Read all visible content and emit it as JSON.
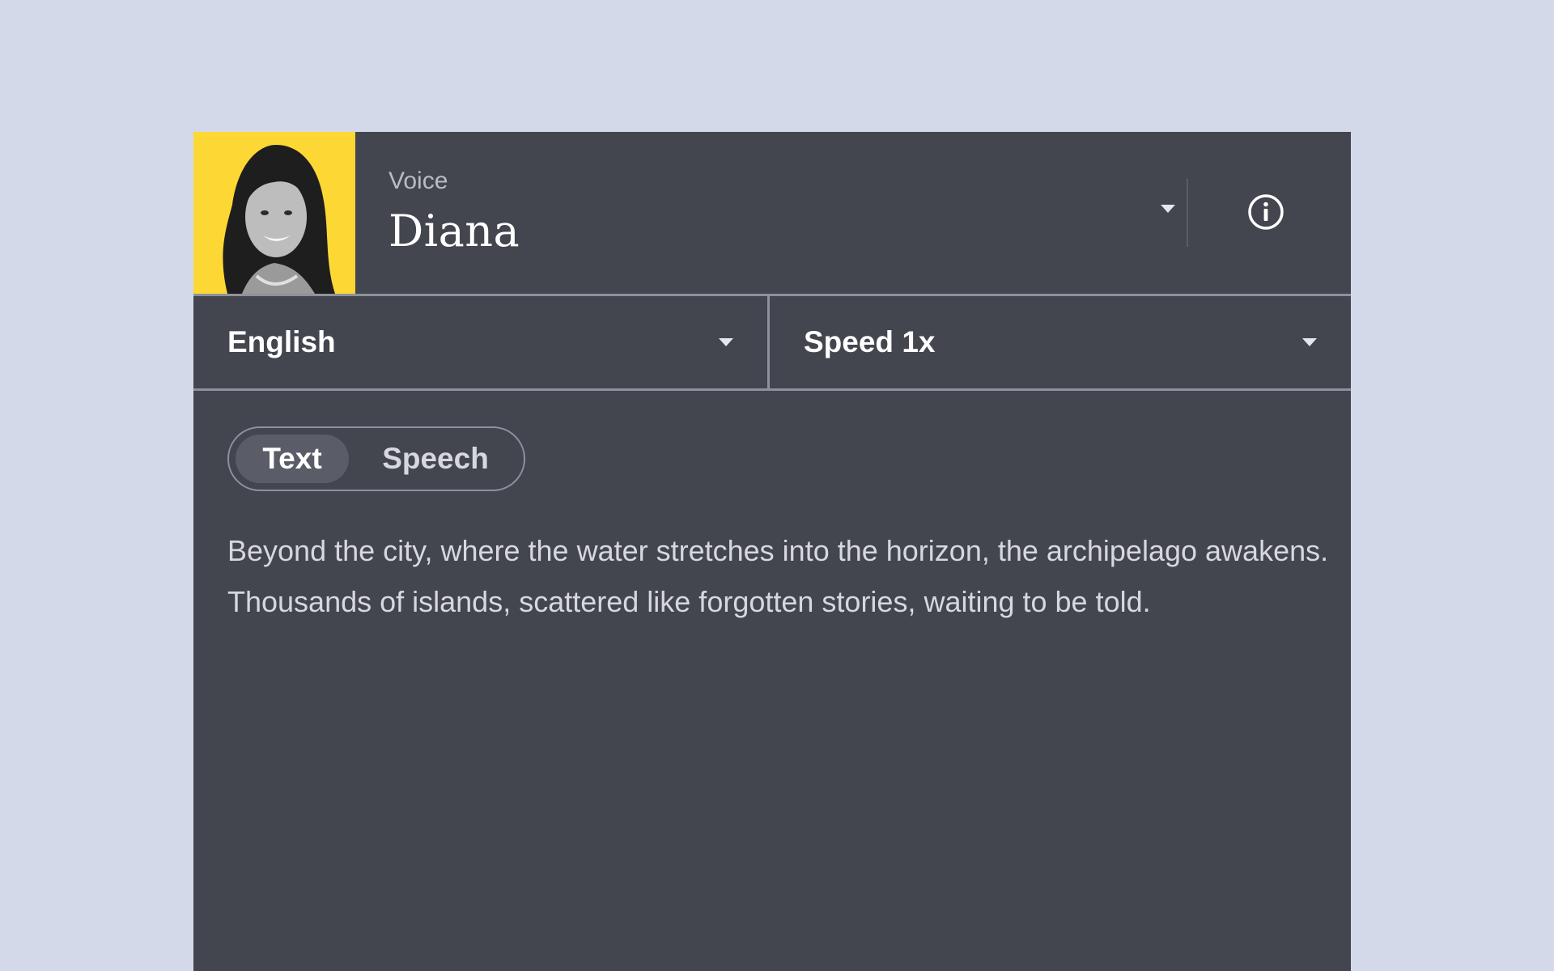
{
  "voice": {
    "label": "Voice",
    "name": "Diana",
    "avatar_bg": "#fdd835"
  },
  "icons": {
    "caret": "chevron-down-icon",
    "info": "info-icon"
  },
  "language": {
    "value": "English"
  },
  "speed": {
    "value": "Speed 1x"
  },
  "mode_toggle": {
    "options": [
      "Text",
      "Speech"
    ],
    "selected": "Text"
  },
  "content": {
    "text": "Beyond the city, where the water stretches into the horizon, the archipelago awakens. Thousands of islands, scattered like forgotten stories, waiting to be told."
  },
  "colors": {
    "page_bg": "#d3d9e8",
    "panel_bg": "#43454f",
    "accent": "#fdd835"
  }
}
